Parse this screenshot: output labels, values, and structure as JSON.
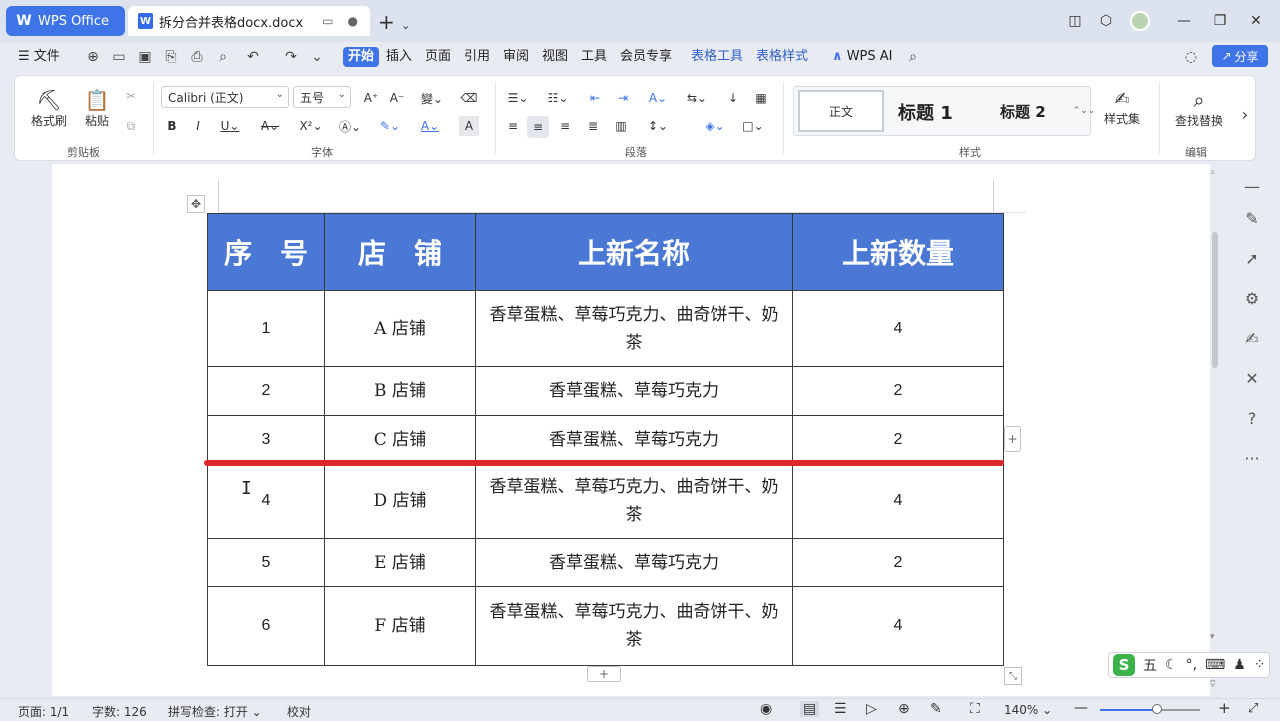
{
  "tabs": {
    "app_label": "WPS Office",
    "doc_label": "拆分合并表格docx.docx"
  },
  "menu": {
    "file": "文件",
    "start": "开始",
    "insert": "插入",
    "page": "页面",
    "reference": "引用",
    "review": "审阅",
    "view": "视图",
    "tools": "工具",
    "member": "会员专享",
    "table_tools": "表格工具",
    "table_style": "表格样式",
    "wps_ai": "WPS AI",
    "share": "分享"
  },
  "ribbon": {
    "format_painter": "格式刷",
    "paste": "粘贴",
    "clipboard_group": "剪贴板",
    "font_name": "Calibri (正文)",
    "font_size": "五号",
    "font_group": "字体",
    "paragraph_group": "段落",
    "style_normal": "正文",
    "style_h1": "标题 1",
    "style_h2": "标题 2",
    "style_set": "样式集",
    "styles_group": "样式",
    "find_replace": "查找替换",
    "edit_group": "编辑"
  },
  "table": {
    "headers": [
      "序　号",
      "店　铺",
      "上新名称",
      "上新数量"
    ],
    "rows": [
      {
        "no": "1",
        "shop": "A 店铺",
        "name": "香草蛋糕、草莓巧克力、曲奇饼干、奶茶",
        "qty": "4"
      },
      {
        "no": "2",
        "shop": "B 店铺",
        "name": "香草蛋糕、草莓巧克力",
        "qty": "2"
      },
      {
        "no": "3",
        "shop": "C 店铺",
        "name": "香草蛋糕、草莓巧克力",
        "qty": "2"
      },
      {
        "no": "4",
        "shop": "D 店铺",
        "name": "香草蛋糕、草莓巧克力、曲奇饼干、奶茶",
        "qty": "4"
      },
      {
        "no": "5",
        "shop": "E 店铺",
        "name": "香草蛋糕、草莓巧克力",
        "qty": "2"
      },
      {
        "no": "6",
        "shop": "F 店铺",
        "name": "香草蛋糕、草莓巧克力、曲奇饼干、奶茶",
        "qty": "4"
      }
    ]
  },
  "status": {
    "page": "页面: 1/1",
    "word_count": "字数: 126",
    "spell_check": "拼写检查: 打开",
    "proofread": "校对",
    "zoom": "140%"
  },
  "ime": {
    "logo": "S",
    "mode": "五"
  },
  "colors": {
    "accent": "#3f73e8",
    "header_fill": "#4a78d4",
    "red_line": "#e02828"
  },
  "icons": [
    "wps-logo-icon",
    "doc-icon",
    "new-tab-icon",
    "menu-icon",
    "save-icon",
    "print-icon",
    "undo-icon",
    "redo-icon",
    "search-icon",
    "format-painter-icon",
    "paste-icon",
    "cut-icon",
    "copy-icon",
    "bold-icon",
    "italic-icon",
    "underline-icon",
    "find-icon",
    "eye-icon",
    "zoom-out-icon",
    "zoom-in-icon",
    "pen-icon",
    "cursor-icon",
    "help-icon",
    "more-icon"
  ]
}
